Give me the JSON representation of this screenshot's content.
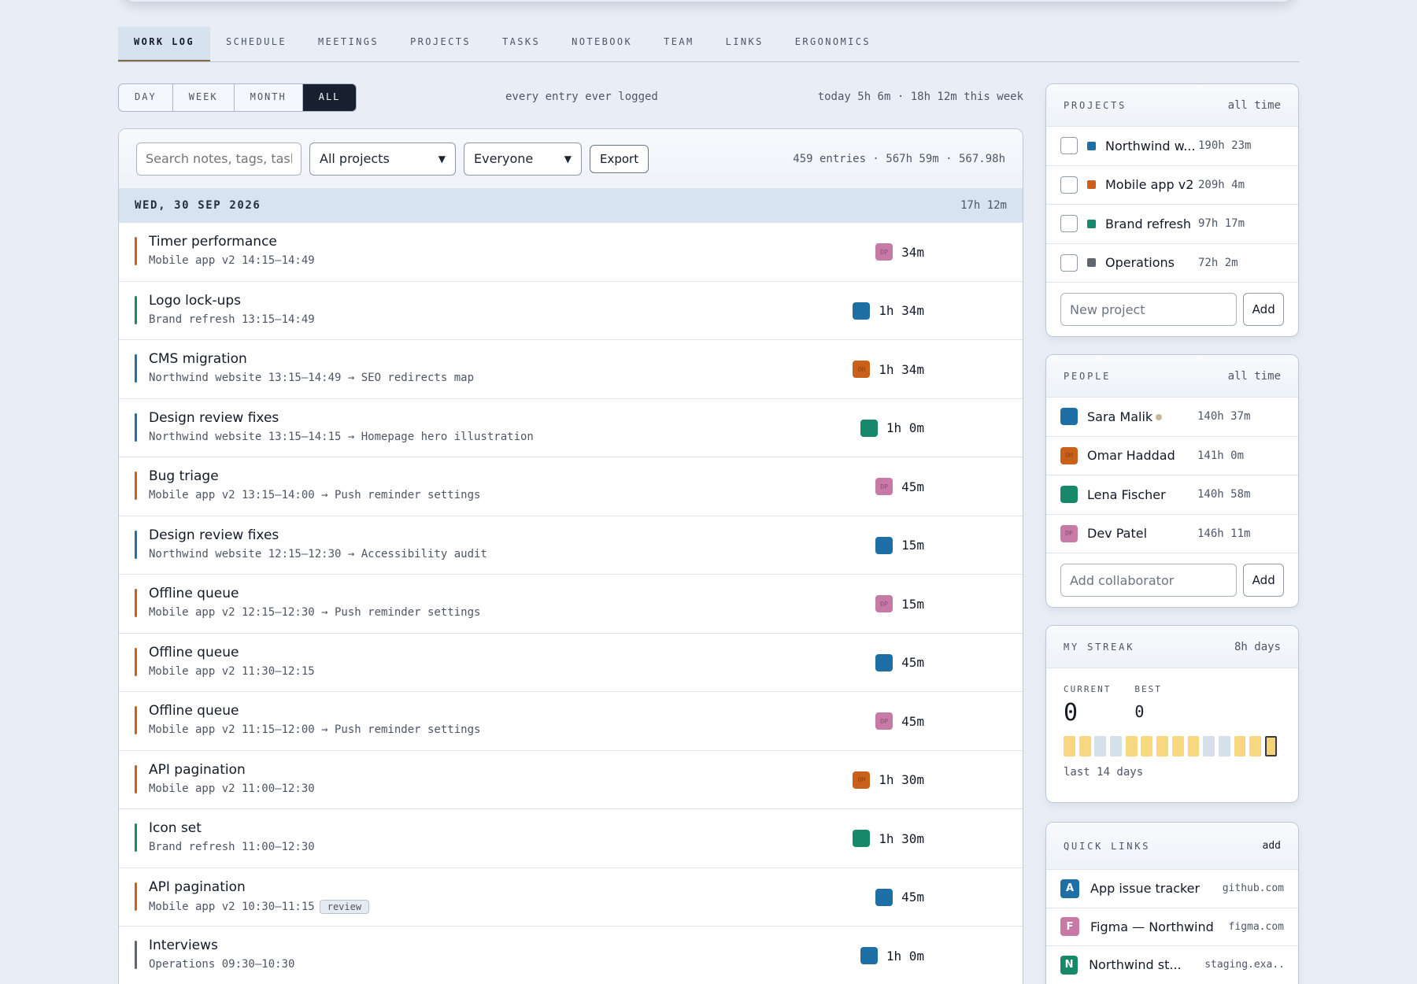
{
  "nav": {
    "tabs": [
      "WORK LOG",
      "SCHEDULE",
      "MEETINGS",
      "PROJECTS",
      "TASKS",
      "NOTEBOOK",
      "TEAM",
      "LINKS",
      "ERGONOMICS"
    ],
    "active": "WORK LOG"
  },
  "range": {
    "options": [
      "DAY",
      "WEEK",
      "MONTH",
      "ALL"
    ],
    "active": "ALL",
    "caption": "every entry ever logged",
    "totals": "today 5h 6m · 18h 12m this week"
  },
  "filters": {
    "search_placeholder": "Search notes, tags, tasks",
    "project_select": "All projects",
    "people_select": "Everyone",
    "export_label": "Export",
    "summary": "459 entries · 567h 59m · 567.98h"
  },
  "day": {
    "date": "WED, 30 SEP 2026",
    "total": "17h 12m"
  },
  "colors": {
    "northwind": "#1d6fa5",
    "mobile": "#c9611a",
    "brand": "#17896a",
    "operations": "#5f6670",
    "sara": "#1d6fa5",
    "omar": "#c9611a",
    "lena": "#17896a",
    "dev": "#c77aa6"
  },
  "entries": [
    {
      "title": "Timer performance",
      "meta": "Mobile app v2 14:15–14:49",
      "tag": "",
      "duration": "34m",
      "avatar": "DP",
      "bar_color": "#c9611a",
      "avatar_color": "#c77aa6"
    },
    {
      "title": "Logo lock-ups",
      "meta": "Brand refresh 13:15–14:49",
      "tag": "",
      "duration": "1h 34m",
      "avatar": "",
      "bar_color": "#17896a",
      "avatar_color": "#1d6fa5"
    },
    {
      "title": "CMS migration",
      "meta": "Northwind website 13:15–14:49 → SEO redirects map",
      "tag": "",
      "duration": "1h 34m",
      "avatar": "OH",
      "bar_color": "#1d6fa5",
      "avatar_color": "#c9611a"
    },
    {
      "title": "Design review fixes",
      "meta": "Northwind website 13:15–14:15 → Homepage hero illustration",
      "tag": "",
      "duration": "1h 0m",
      "avatar": "",
      "bar_color": "#1d6fa5",
      "avatar_color": "#17896a"
    },
    {
      "title": "Bug triage",
      "meta": "Mobile app v2 13:15–14:00 → Push reminder settings",
      "tag": "",
      "duration": "45m",
      "avatar": "DP",
      "bar_color": "#c9611a",
      "avatar_color": "#c77aa6"
    },
    {
      "title": "Design review fixes",
      "meta": "Northwind website 12:15–12:30 → Accessibility audit",
      "tag": "",
      "duration": "15m",
      "avatar": "",
      "bar_color": "#1d6fa5",
      "avatar_color": "#1d6fa5"
    },
    {
      "title": "Offline queue",
      "meta": "Mobile app v2 12:15–12:30 → Push reminder settings",
      "tag": "",
      "duration": "15m",
      "avatar": "DP",
      "bar_color": "#c9611a",
      "avatar_color": "#c77aa6"
    },
    {
      "title": "Offline queue",
      "meta": "Mobile app v2 11:30–12:15",
      "tag": "",
      "duration": "45m",
      "avatar": "",
      "bar_color": "#c9611a",
      "avatar_color": "#1d6fa5"
    },
    {
      "title": "Offline queue",
      "meta": "Mobile app v2 11:15–12:00 → Push reminder settings",
      "tag": "",
      "duration": "45m",
      "avatar": "DP",
      "bar_color": "#c9611a",
      "avatar_color": "#c77aa6"
    },
    {
      "title": "API pagination",
      "meta": "Mobile app v2 11:00–12:30",
      "tag": "",
      "duration": "1h 30m",
      "avatar": "OH",
      "bar_color": "#c9611a",
      "avatar_color": "#c9611a"
    },
    {
      "title": "Icon set",
      "meta": "Brand refresh 11:00–12:30",
      "tag": "",
      "duration": "1h 30m",
      "avatar": "",
      "bar_color": "#17896a",
      "avatar_color": "#17896a"
    },
    {
      "title": "API pagination",
      "meta": "Mobile app v2 10:30–11:15",
      "tag": "review",
      "duration": "45m",
      "avatar": "",
      "bar_color": "#c9611a",
      "avatar_color": "#1d6fa5"
    },
    {
      "title": "Interviews",
      "meta": "Operations 09:30–10:30",
      "tag": "",
      "duration": "1h 0m",
      "avatar": "",
      "bar_color": "#5f6670",
      "avatar_color": "#1d6fa5"
    }
  ],
  "projects": {
    "heading": "PROJECTS",
    "scope": "all time",
    "items": [
      {
        "name": "Northwind w...",
        "time": "190h 23m",
        "color": "#1d6fa5"
      },
      {
        "name": "Mobile app v2",
        "time": "209h 4m",
        "color": "#c9611a"
      },
      {
        "name": "Brand refresh",
        "time": "97h 17m",
        "color": "#17896a"
      },
      {
        "name": "Operations",
        "time": "72h 2m",
        "color": "#5f6670"
      }
    ],
    "new_placeholder": "New project",
    "add_label": "Add"
  },
  "people": {
    "heading": "PEOPLE",
    "scope": "all time",
    "items": [
      {
        "name": "Sara Malik",
        "time": "140h 37m",
        "color": "#1d6fa5",
        "initials": "",
        "online": true
      },
      {
        "name": "Omar Haddad",
        "time": "141h 0m",
        "color": "#c9611a",
        "initials": "OH",
        "online": false
      },
      {
        "name": "Lena Fischer",
        "time": "140h 58m",
        "color": "#17896a",
        "initials": "",
        "online": false
      },
      {
        "name": "Dev Patel",
        "time": "146h 11m",
        "color": "#c77aa6",
        "initials": "DP",
        "online": false
      }
    ],
    "add_placeholder": "Add collaborator",
    "add_label": "Add"
  },
  "streak": {
    "heading": "MY STREAK",
    "scope": "8h days",
    "current_label": "CURRENT",
    "current": "0",
    "best_label": "BEST",
    "best": "0",
    "days": [
      1,
      1,
      0,
      0,
      1,
      1,
      1,
      1,
      1,
      0,
      0,
      1,
      1,
      2
    ],
    "footer": "last 14 days"
  },
  "links": {
    "heading": "QUICK LINKS",
    "add_label": "add",
    "items": [
      {
        "badge": "A",
        "name": "App issue tracker",
        "domain": "github.com",
        "color": "#1d6fa5"
      },
      {
        "badge": "F",
        "name": "Figma — Northwind",
        "domain": "figma.com",
        "color": "#c77aa6"
      },
      {
        "badge": "N",
        "name": "Northwind st...",
        "domain": "staging.exa...",
        "color": "#17896a"
      }
    ]
  }
}
